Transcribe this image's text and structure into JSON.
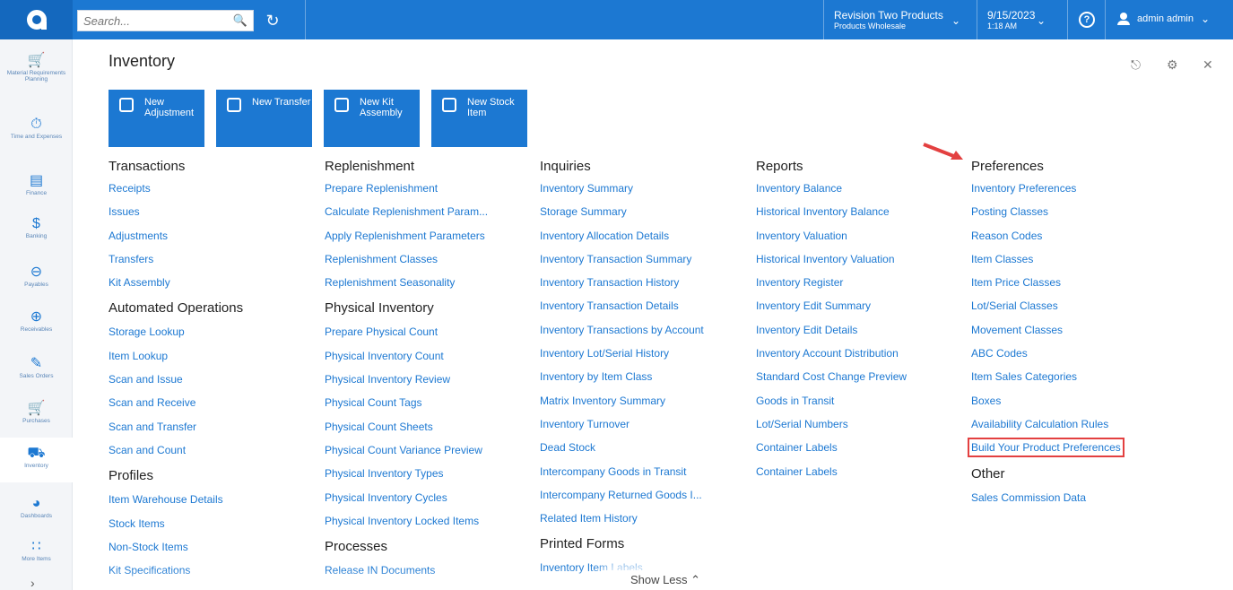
{
  "topbar": {
    "search_placeholder": "Search...",
    "company": {
      "name": "Revision Two Products",
      "branch": "Products Wholesale"
    },
    "date": {
      "date": "9/15/2023",
      "time": "1:18 AM"
    },
    "user": "admin admin"
  },
  "sidebar": [
    {
      "label": "Material Requirements Planning",
      "icon": "cart-plus-icon"
    },
    {
      "label": "Time and Expenses",
      "icon": "stopwatch-icon"
    },
    {
      "label": "Finance",
      "icon": "calculator-icon"
    },
    {
      "label": "Banking",
      "icon": "dollar-icon"
    },
    {
      "label": "Payables",
      "icon": "minus-circle-icon"
    },
    {
      "label": "Receivables",
      "icon": "plus-circle-icon"
    },
    {
      "label": "Sales Orders",
      "icon": "pencil-square-icon"
    },
    {
      "label": "Purchases",
      "icon": "cart-icon"
    },
    {
      "label": "Inventory",
      "icon": "truck-icon"
    },
    {
      "label": "Dashboards",
      "icon": "gauge-icon"
    },
    {
      "label": "More Items",
      "icon": "grid-icon"
    }
  ],
  "page": {
    "title": "Inventory"
  },
  "tiles": [
    {
      "label": "New Adjustment",
      "icon": "pencil-icon"
    },
    {
      "label": "New Transfer",
      "icon": "truck-icon"
    },
    {
      "label": "New Kit Assembly",
      "icon": "nodes-icon"
    },
    {
      "label": "New Stock Item",
      "icon": "briefcase-icon"
    }
  ],
  "columns": [
    {
      "groups": [
        {
          "heading": "Transactions",
          "links": [
            "Receipts",
            "Issues",
            "Adjustments",
            "Transfers",
            "Kit Assembly"
          ]
        },
        {
          "heading": "Automated Operations",
          "links": [
            "Storage Lookup",
            "Item Lookup",
            "Scan and Issue",
            "Scan and Receive",
            "Scan and Transfer",
            "Scan and Count"
          ]
        },
        {
          "heading": "Profiles",
          "links": [
            "Item Warehouse Details",
            "Stock Items",
            "Non-Stock Items",
            "Kit Specifications"
          ]
        }
      ]
    },
    {
      "groups": [
        {
          "heading": "Replenishment",
          "links": [
            "Prepare Replenishment",
            "Calculate Replenishment Param...",
            "Apply Replenishment Parameters",
            "Replenishment Classes",
            "Replenishment Seasonality"
          ]
        },
        {
          "heading": "Physical Inventory",
          "links": [
            "Prepare Physical Count",
            "Physical Inventory Count",
            "Physical Inventory Review",
            "Physical Count Tags",
            "Physical Count Sheets",
            "Physical Count Variance Preview",
            "Physical Inventory Types",
            "Physical Inventory Cycles",
            "Physical Inventory Locked Items"
          ]
        },
        {
          "heading": "Processes",
          "links": [
            "Release IN Documents"
          ]
        }
      ]
    },
    {
      "groups": [
        {
          "heading": "Inquiries",
          "links": [
            "Inventory Summary",
            "Storage Summary",
            "Inventory Allocation Details",
            "Inventory Transaction Summary",
            "Inventory Transaction History",
            "Inventory Transaction Details",
            "Inventory Transactions by Account",
            "Inventory Lot/Serial History",
            "Inventory by Item Class",
            "Matrix Inventory Summary",
            "Inventory Turnover",
            "Dead Stock",
            "Intercompany Goods in Transit",
            "Intercompany Returned Goods I...",
            "Related Item History"
          ]
        },
        {
          "heading": "Printed Forms",
          "links": [
            "Inventory Item Labels"
          ]
        }
      ]
    },
    {
      "groups": [
        {
          "heading": "Reports",
          "links": [
            "Inventory Balance",
            "Historical Inventory Balance",
            "Inventory Valuation",
            "Historical Inventory Valuation",
            "Inventory Register",
            "Inventory Edit Summary",
            "Inventory Edit Details",
            "Inventory Account Distribution",
            "Standard Cost Change Preview",
            "Goods in Transit",
            "Lot/Serial Numbers",
            "Container Labels",
            "Container Labels"
          ]
        }
      ]
    },
    {
      "groups": [
        {
          "heading": "Preferences",
          "links": [
            "Inventory Preferences",
            "Posting Classes",
            "Reason Codes",
            "Item Classes",
            "Item Price Classes",
            "Lot/Serial Classes",
            "Movement Classes",
            "ABC Codes",
            "Item Sales Categories",
            "Boxes",
            "Availability Calculation Rules",
            "Build Your Product Preferences"
          ]
        },
        {
          "heading": "Other",
          "links": [
            "Sales Commission Data"
          ]
        }
      ]
    }
  ],
  "highlighted_link": "Build Your Product Preferences",
  "footer": {
    "show_less": "Show Less"
  },
  "colors": {
    "brand": "#1c78d2",
    "highlight": "#e34040"
  }
}
